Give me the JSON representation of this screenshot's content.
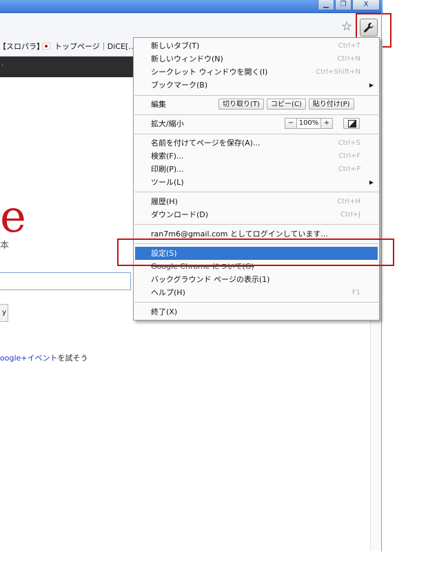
{
  "window": {
    "controls": {
      "minimize": "▁",
      "restore": "❐",
      "close": "X"
    }
  },
  "toolbar": {
    "star_icon": "☆",
    "wrench_icon": "wrench-icon"
  },
  "bookmarks": [
    {
      "label": "【スロパラ】"
    },
    {
      "label": "トップページ｜DiCE[…"
    }
  ],
  "page": {
    "logo_letter": "e",
    "logo_sub": "本",
    "search_button": "y",
    "promo_link": "oogle+イベント",
    "promo_text": "を試そう"
  },
  "menu": {
    "items": [
      {
        "label": "新しいタブ(T)",
        "shortcut": "Ctrl+T"
      },
      {
        "label": "新しいウィンドウ(N)",
        "shortcut": "Ctrl+N"
      },
      {
        "label": "シークレット ウィンドウを開く(I)",
        "shortcut": "Ctrl+Shift+N"
      },
      {
        "label": "ブックマーク(B)",
        "submenu": "▶"
      },
      {
        "label": "編集"
      },
      {
        "label": "拡大/縮小"
      },
      {
        "label": "名前を付けてページを保存(A)...",
        "shortcut": "Ctrl+S"
      },
      {
        "label": "検索(F)...",
        "shortcut": "Ctrl+F"
      },
      {
        "label": "印刷(P)...",
        "shortcut": "Ctrl+P"
      },
      {
        "label": "ツール(L)",
        "submenu": "▶"
      },
      {
        "label": "履歴(H)",
        "shortcut": "Ctrl+H"
      },
      {
        "label": "ダウンロード(D)",
        "shortcut": "Ctrl+J"
      },
      {
        "label": "ran7m6@gmail.com としてログインしています..."
      },
      {
        "label": "設定(S)"
      },
      {
        "label": "Google Chrome について(G)"
      },
      {
        "label": "バックグラウンド ページの表示(1)"
      },
      {
        "label": "ヘルプ(H)",
        "shortcut": "F1"
      },
      {
        "label": "終了(X)"
      }
    ],
    "edit_buttons": {
      "cut": "切り取り(T)",
      "copy": "コピー(C)",
      "paste": "貼り付け(P)"
    },
    "zoom": {
      "minus": "−",
      "value": "100%",
      "plus": "+"
    }
  }
}
